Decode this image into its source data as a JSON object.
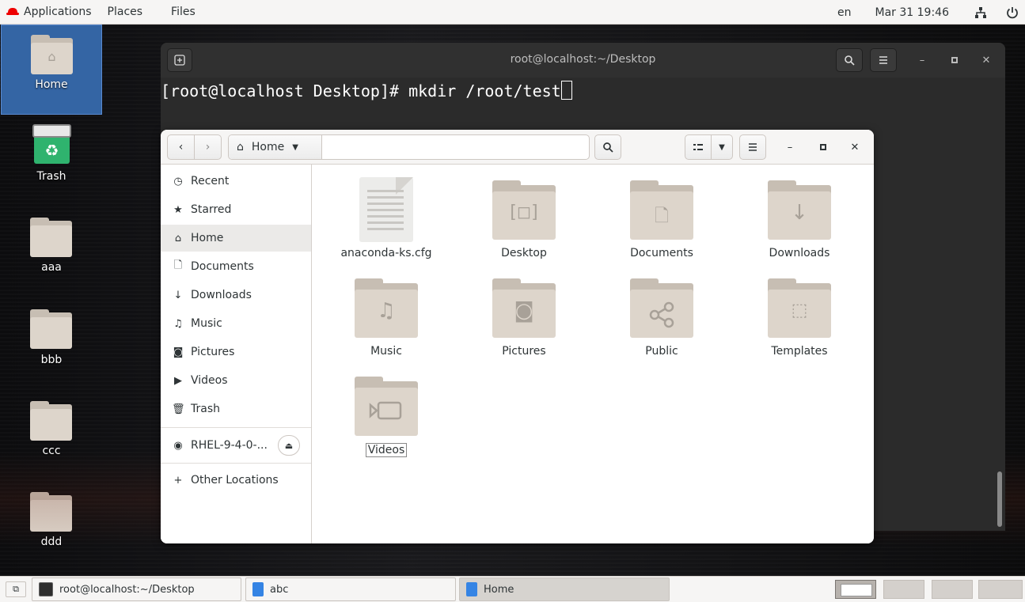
{
  "topbar": {
    "applications": "Applications",
    "places": "Places",
    "files": "Files",
    "lang": "en",
    "clock": "Mar 31 19:46"
  },
  "desktop_icons": [
    {
      "label": "Home",
      "icon": "home-folder-icon"
    },
    {
      "label": "Trash",
      "icon": "trash-icon"
    },
    {
      "label": "aaa",
      "icon": "folder-icon"
    },
    {
      "label": "bbb",
      "icon": "folder-icon"
    },
    {
      "label": "ccc",
      "icon": "folder-icon"
    },
    {
      "label": "ddd",
      "icon": "folder-icon"
    }
  ],
  "terminal": {
    "title": "root@localhost:~/Desktop",
    "command_line": "[root@localhost Desktop]# mkdir /root/test"
  },
  "files": {
    "path": "Home",
    "sidebar": [
      {
        "label": "Recent",
        "icon": "clock-icon"
      },
      {
        "label": "Starred",
        "icon": "star-icon"
      },
      {
        "label": "Home",
        "icon": "home-icon"
      },
      {
        "label": "Documents",
        "icon": "document-icon"
      },
      {
        "label": "Downloads",
        "icon": "download-icon"
      },
      {
        "label": "Music",
        "icon": "music-icon"
      },
      {
        "label": "Pictures",
        "icon": "camera-icon"
      },
      {
        "label": "Videos",
        "icon": "video-icon"
      },
      {
        "label": "Trash",
        "icon": "trash-icon"
      },
      {
        "label": "RHEL-9-4-0-...",
        "icon": "disc-icon"
      },
      {
        "label": "Other Locations",
        "icon": "plus-icon"
      }
    ],
    "items": [
      {
        "label": "anaconda-ks.cfg",
        "type": "file"
      },
      {
        "label": "Desktop",
        "type": "folder"
      },
      {
        "label": "Documents",
        "type": "folder"
      },
      {
        "label": "Downloads",
        "type": "folder"
      },
      {
        "label": "Music",
        "type": "folder"
      },
      {
        "label": "Pictures",
        "type": "folder"
      },
      {
        "label": "Public",
        "type": "folder"
      },
      {
        "label": "Templates",
        "type": "folder"
      },
      {
        "label": "Videos",
        "type": "folder"
      }
    ]
  },
  "taskbar": {
    "tasks": [
      {
        "label": "root@localhost:~/Desktop",
        "icon": "terminal-icon"
      },
      {
        "label": "abc",
        "icon": "text-file-icon"
      },
      {
        "label": "Home",
        "icon": "file-manager-icon"
      }
    ]
  },
  "colors": {
    "accent": "#3465a4",
    "folder": "#ddd5cb",
    "topbar": "#f6f5f4",
    "terminal_bg": "#2b2b2b"
  }
}
